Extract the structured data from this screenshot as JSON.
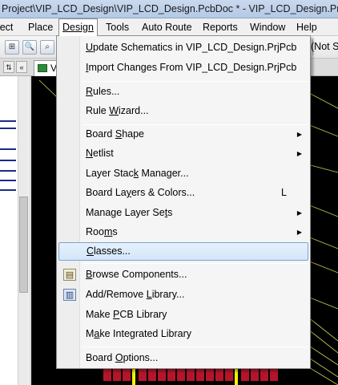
{
  "window": {
    "title": "Project\\VIP_LCD_Design\\VIP_LCD_Design.PcbDoc * - VIP_LCD_Design.PrjPcb. S"
  },
  "menubar": {
    "items": [
      {
        "label": "oject",
        "name": "menu-project"
      },
      {
        "label": "Place",
        "name": "menu-place"
      },
      {
        "label": "Design",
        "name": "menu-design"
      },
      {
        "label": "Tools",
        "name": "menu-tools"
      },
      {
        "label": "Auto Route",
        "name": "menu-auto-route"
      },
      {
        "label": "Reports",
        "name": "menu-reports"
      },
      {
        "label": "Window",
        "name": "menu-window"
      },
      {
        "label": "Help",
        "name": "menu-help"
      }
    ]
  },
  "toolbar": {
    "right_text": "(Not Sa"
  },
  "tabs": {
    "doc_tab_label": "V"
  },
  "design_menu": {
    "items": [
      {
        "pre": "",
        "u": "U",
        "post": "pdate Schematics in VIP_LCD_Design.PrjPcb"
      },
      {
        "pre": "",
        "u": "I",
        "post": "mport Changes From VIP_LCD_Design.PrjPcb"
      },
      {
        "pre": "",
        "u": "R",
        "post": "ules..."
      },
      {
        "pre": "Rule ",
        "u": "W",
        "post": "izard..."
      },
      {
        "pre": "Board ",
        "u": "S",
        "post": "hape"
      },
      {
        "pre": "",
        "u": "N",
        "post": "etlist"
      },
      {
        "pre": "Layer Stac",
        "u": "k",
        "post": " Manager..."
      },
      {
        "pre": "Board La",
        "u": "y",
        "post": "ers & Colors..."
      },
      {
        "pre": "Manage Layer Se",
        "u": "t",
        "post": "s"
      },
      {
        "pre": "Roo",
        "u": "m",
        "post": "s"
      },
      {
        "pre": "",
        "u": "C",
        "post": "lasses..."
      },
      {
        "pre": "",
        "u": "B",
        "post": "rowse Components..."
      },
      {
        "pre": "Add/Remove ",
        "u": "L",
        "post": "ibrary..."
      },
      {
        "pre": "Make ",
        "u": "P",
        "post": "CB Library"
      },
      {
        "pre": "M",
        "u": "a",
        "post": "ke Integrated Library"
      },
      {
        "pre": "Board ",
        "u": "O",
        "post": "ptions..."
      }
    ],
    "shortcut_layers": "L",
    "submenu_arrow": "▶"
  },
  "icons": {
    "browse_components": "browse-components-icon",
    "add_remove_library": "add-remove-library-icon"
  },
  "colors": {
    "highlight_border": "#7da2ce",
    "canvas": "#000000",
    "pad_red": "#b5152b",
    "track_yellow": "#f2f200"
  }
}
